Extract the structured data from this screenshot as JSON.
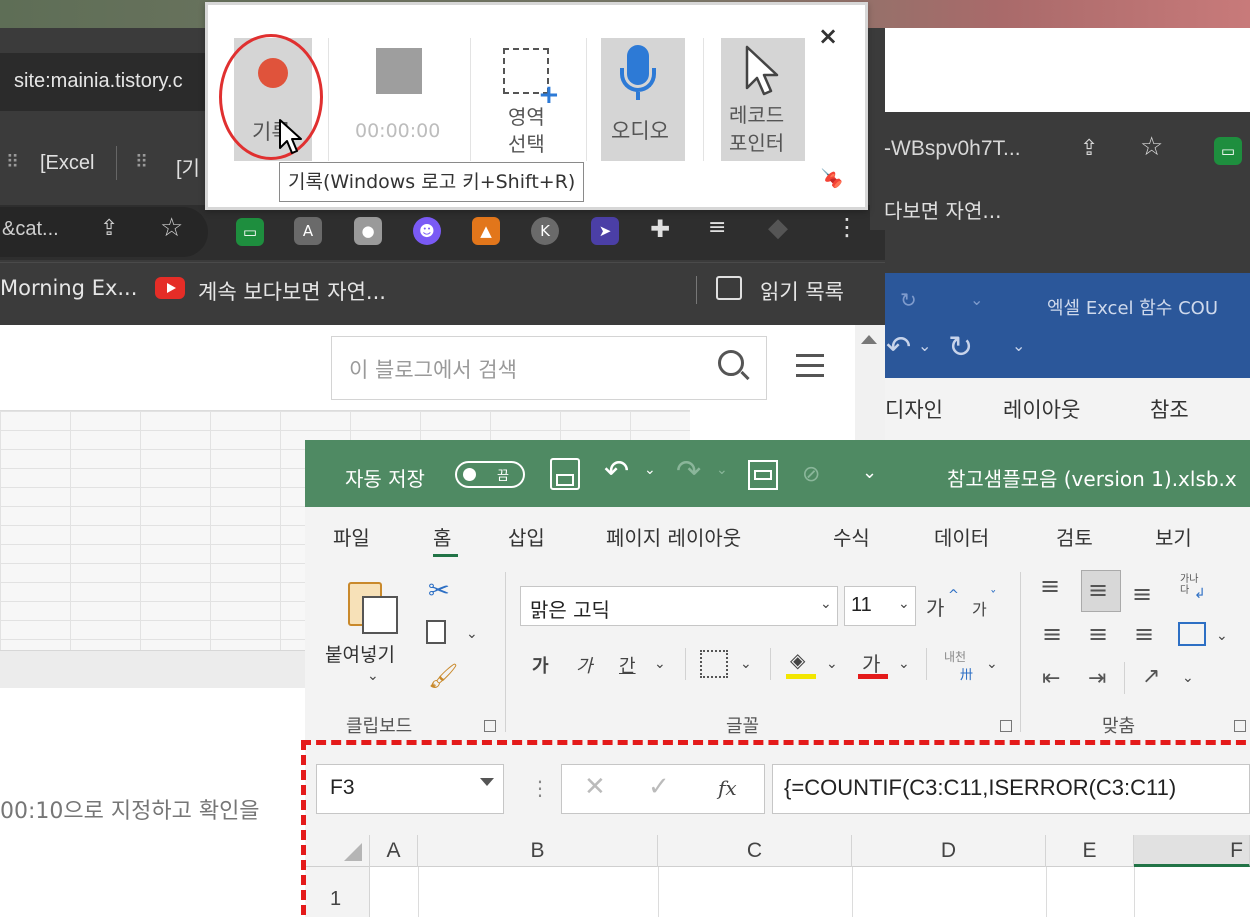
{
  "browser_left": {
    "address": "site:mainia.tistory.c",
    "tabs": [
      "[Excel",
      "[기"
    ],
    "url_fragment": "&cat...",
    "bookmarks": {
      "item1": "Morning Ex...",
      "item2": "계속 보다보면 자연...",
      "reading_list": "읽기 목록"
    },
    "search_placeholder": "이 블로그에서 검색",
    "body_text": "00:10으로 지정하고 확인을"
  },
  "browser_right": {
    "url_fragment": "-WBspv0h7T...",
    "bookmark": "다보면 자연..."
  },
  "word": {
    "title": "엑셀 Excel 함수 COU",
    "tabs": [
      "디자인",
      "레이아웃",
      "참조"
    ]
  },
  "excel": {
    "autosave_label": "자동 저장",
    "autosave_state": "끔",
    "file_title": "참고샘플모음 (version 1).xlsb.x",
    "tabs": [
      "파일",
      "홈",
      "삽입",
      "페이지 레이아웃",
      "수식",
      "데이터",
      "검토",
      "보기"
    ],
    "active_tab": "홈",
    "paste_label": "붙여넣기",
    "groups": {
      "clipboard": "클립보드",
      "font": "글꼴",
      "alignment": "맞춤"
    },
    "font_name": "맑은 고딕",
    "font_size": "11",
    "grow_font": "가",
    "shrink_font": "가",
    "bold": "가",
    "italic": "가",
    "underline": "간",
    "font_color_glyph": "가",
    "phonetic": "내천",
    "wrap_text": "가나\n다",
    "name_box": "F3",
    "formula": "{=COUNTIF(C3:C11,ISERROR(C3:C11)",
    "fx_label": "fx",
    "columns": [
      "A",
      "B",
      "C",
      "D",
      "E",
      "F"
    ],
    "rows": [
      "1"
    ]
  },
  "recorder": {
    "record_label": "기록",
    "timer": "00:00:00",
    "region_label_line1": "영역",
    "region_label_line2": "선택",
    "audio_label": "오디오",
    "pointer_label_line1": "레코드",
    "pointer_label_line2": "포인터",
    "close": "×",
    "tooltip": "기록(Windows 로고 키+Shift+R)"
  },
  "colors": {
    "record_red": "#e0533b",
    "annotation_red": "#e41a1a",
    "mic_blue": "#2d7ad6",
    "excel_green": "#4f8a63",
    "word_blue": "#2b579a"
  }
}
